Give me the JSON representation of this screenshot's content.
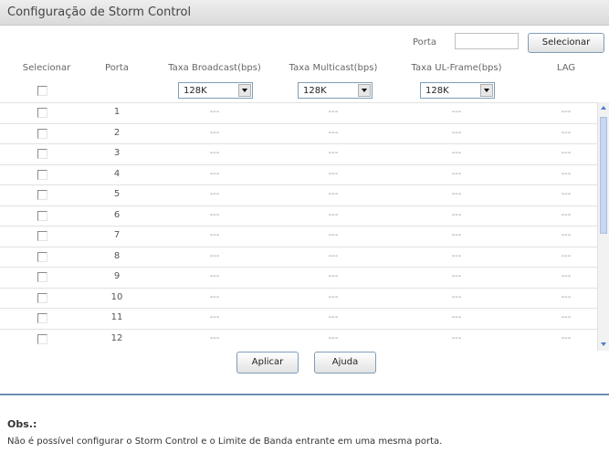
{
  "page": {
    "title": "Configuração de Storm Control",
    "porta_label": "Porta",
    "porta_value": "",
    "select_button": "Selecionar"
  },
  "table": {
    "headers": {
      "select": "Selecionar",
      "port": "Porta",
      "broadcast": "Taxa Broadcast(bps)",
      "multicast": "Taxa Multicast(bps)",
      "ul_frame": "Taxa UL-Frame(bps)",
      "lag": "LAG"
    },
    "dropdowns": {
      "broadcast": "128K",
      "multicast": "128K",
      "ul_frame": "128K"
    },
    "rows": [
      {
        "port": "1",
        "broadcast": "---",
        "multicast": "---",
        "ul_frame": "---",
        "lag": "---"
      },
      {
        "port": "2",
        "broadcast": "---",
        "multicast": "---",
        "ul_frame": "---",
        "lag": "---"
      },
      {
        "port": "3",
        "broadcast": "---",
        "multicast": "---",
        "ul_frame": "---",
        "lag": "---"
      },
      {
        "port": "4",
        "broadcast": "---",
        "multicast": "---",
        "ul_frame": "---",
        "lag": "---"
      },
      {
        "port": "5",
        "broadcast": "---",
        "multicast": "---",
        "ul_frame": "---",
        "lag": "---"
      },
      {
        "port": "6",
        "broadcast": "---",
        "multicast": "---",
        "ul_frame": "---",
        "lag": "---"
      },
      {
        "port": "7",
        "broadcast": "---",
        "multicast": "---",
        "ul_frame": "---",
        "lag": "---"
      },
      {
        "port": "8",
        "broadcast": "---",
        "multicast": "---",
        "ul_frame": "---",
        "lag": "---"
      },
      {
        "port": "9",
        "broadcast": "---",
        "multicast": "---",
        "ul_frame": "---",
        "lag": "---"
      },
      {
        "port": "10",
        "broadcast": "---",
        "multicast": "---",
        "ul_frame": "---",
        "lag": "---"
      },
      {
        "port": "11",
        "broadcast": "---",
        "multicast": "---",
        "ul_frame": "---",
        "lag": "---"
      },
      {
        "port": "12",
        "broadcast": "---",
        "multicast": "---",
        "ul_frame": "---",
        "lag": "---"
      }
    ]
  },
  "actions": {
    "apply": "Aplicar",
    "help": "Ajuda"
  },
  "note": {
    "title": "Obs.:",
    "text": "Não é possível configurar o Storm Control e o Limite de Banda entrante em uma mesma porta."
  }
}
